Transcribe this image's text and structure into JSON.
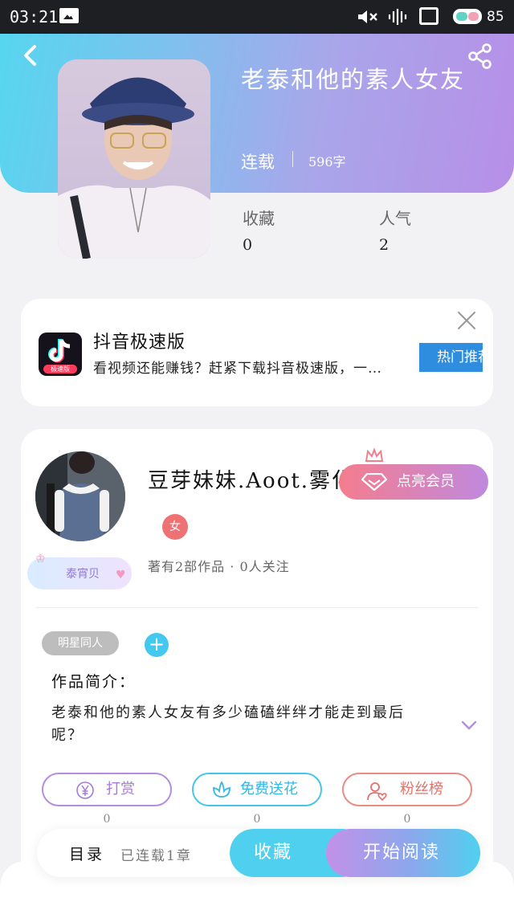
{
  "status_bar": {
    "time": "03:21",
    "battery": "85"
  },
  "book": {
    "title": "老泰和他的素人女友",
    "status": "连载",
    "word_count": "596字",
    "stats": [
      {
        "label": "收藏",
        "value": "0"
      },
      {
        "label": "人气",
        "value": "2"
      }
    ]
  },
  "ad": {
    "title": "抖音极速版",
    "description": "看视频还能赚钱？赶紧下载抖音极速版，一…",
    "button": "热门推荐",
    "logo_tag": "极速版"
  },
  "author": {
    "name": "豆芽妹妹.Aoot.雾化",
    "gender": "女",
    "badge": "泰宵贝",
    "stats": "著有2部作品 · 0人关注",
    "vip_button": "点亮会员"
  },
  "tags": [
    "明星同人"
  ],
  "intro": {
    "label": "作品简介：",
    "text": "老泰和他的素人女友有多少磕磕绊绊才能走到最后呢？"
  },
  "actions": [
    {
      "label": "打赏",
      "icon": "yen-coin-icon",
      "count": "0"
    },
    {
      "label": "免费送花",
      "icon": "flower-icon",
      "count": "0"
    },
    {
      "label": "粉丝榜",
      "icon": "fans-icon",
      "count": "0"
    }
  ],
  "bottom_bar": {
    "toc": "目录",
    "chapters": "已连载1章",
    "collect": "收藏",
    "read": "开始阅读"
  },
  "colors": {
    "header_gradient": [
      "#56d6ef",
      "#b78fe7"
    ],
    "accent_blue": "#4fd0ee",
    "accent_purple": "#c291e8",
    "tip": "#a27bdc",
    "flower": "#34b6e6",
    "fans": "#e4706b"
  }
}
